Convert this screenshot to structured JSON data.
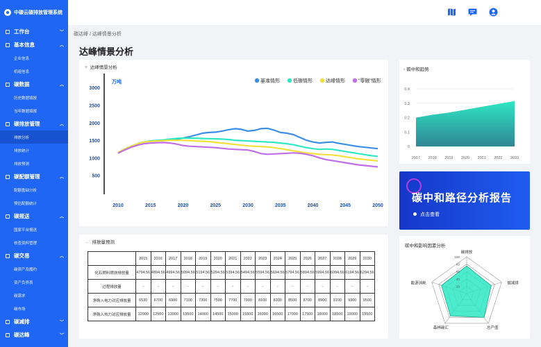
{
  "app": {
    "title": "中碳云碳排放管理系统"
  },
  "sidebar": {
    "groups": [
      {
        "label": "工作台",
        "items": []
      },
      {
        "label": "基本信息",
        "items": [
          "企业信息",
          "机组信息"
        ]
      },
      {
        "label": "碳数据",
        "items": [
          "历史数据填报",
          "当年数据填报"
        ]
      },
      {
        "label": "碳排放管理",
        "items": [
          "排放分析",
          "排放统计",
          "排放预测"
        ]
      },
      {
        "label": "碳配额管理",
        "items": [
          "配额盈缺分析",
          "预估配额统计"
        ]
      },
      {
        "label": "碳报送",
        "items": [
          "国家平台报送",
          "核查资料管理"
        ]
      },
      {
        "label": "碳交易",
        "items": [
          "碳资产及履约",
          "资产负债表",
          "碳需求",
          "碳市场"
        ]
      },
      {
        "label": "碳减排",
        "items": []
      },
      {
        "label": "碳达峰",
        "items": []
      }
    ]
  },
  "header": {
    "breadcrumb": "碳达峰 / 达峰情景分析",
    "page_title": "达峰情景分析",
    "icons": [
      "map-icon",
      "message-icon",
      "user-icon"
    ]
  },
  "main_chart_card": {
    "title": "达峰情景分析",
    "chart_data": {
      "type": "line",
      "title": "",
      "ylabel": "万吨",
      "x": [
        2010,
        2011,
        2012,
        2013,
        2014,
        2015,
        2016,
        2017,
        2018,
        2019,
        2020,
        2021,
        2022,
        2023,
        2024,
        2025,
        2026,
        2027,
        2028,
        2029,
        2030,
        2031,
        2032,
        2033,
        2034,
        2035,
        2036,
        2037,
        2038,
        2039,
        2040,
        2041,
        2042,
        2043,
        2044,
        2045,
        2046,
        2047,
        2048,
        2049,
        2050
      ],
      "xticks": [
        2010,
        2015,
        2020,
        2025,
        2030,
        2035,
        2040,
        2045,
        2050
      ],
      "yticks": [
        500,
        1000,
        1500,
        2000,
        2500,
        3000
      ],
      "ylim": [
        0,
        3200
      ],
      "legend": "top-right",
      "series": [
        {
          "name": "基准情形",
          "color": "#3a8ee6",
          "values": [
            1150,
            1250,
            1330,
            1400,
            1450,
            1480,
            1490,
            1500,
            1510,
            1530,
            1560,
            1600,
            1650,
            1700,
            1720,
            1730,
            1760,
            1800,
            1830,
            1810,
            1760,
            1780,
            1830,
            1840,
            1790,
            1720,
            1700,
            1660,
            1580,
            1500,
            1450,
            1420,
            1440,
            1450,
            1410,
            1380,
            1350,
            1320,
            1300,
            1280,
            1260
          ]
        },
        {
          "name": "低碳情形",
          "color": "#2ee8c4",
          "values": [
            1150,
            1250,
            1330,
            1400,
            1450,
            1480,
            1495,
            1510,
            1530,
            1550,
            1560,
            1560,
            1555,
            1550,
            1545,
            1540,
            1530,
            1520,
            1500,
            1490,
            1480,
            1470,
            1460,
            1450,
            1440,
            1420,
            1400,
            1370,
            1330,
            1290,
            1260,
            1240,
            1250,
            1240,
            1210,
            1180,
            1150,
            1120,
            1090,
            1060,
            1040
          ]
        },
        {
          "name": "达峰情形",
          "color": "#f2e13a",
          "values": [
            1150,
            1250,
            1330,
            1400,
            1450,
            1470,
            1480,
            1490,
            1495,
            1500,
            1495,
            1490,
            1480,
            1470,
            1460,
            1440,
            1420,
            1400,
            1380,
            1360,
            1340,
            1330,
            1320,
            1310,
            1290,
            1260,
            1230,
            1200,
            1170,
            1140,
            1120,
            1100,
            1090,
            1080,
            1060,
            1030,
            1000,
            970,
            950,
            930,
            910
          ]
        },
        {
          "name": "“零碳”情形",
          "color": "#c06ee8",
          "values": [
            1130,
            1220,
            1300,
            1360,
            1400,
            1420,
            1430,
            1435,
            1420,
            1390,
            1350,
            1330,
            1320,
            1310,
            1300,
            1290,
            1270,
            1250,
            1240,
            1230,
            1220,
            1180,
            1120,
            1100,
            1110,
            1120,
            1130,
            1140,
            1130,
            1100,
            1060,
            1000,
            950,
            920,
            890,
            860,
            830,
            800,
            780,
            760,
            740
          ]
        }
      ]
    }
  },
  "forecast_card": {
    "title": "排放量预测",
    "years": [
      "2015",
      "2016",
      "2017",
      "2018",
      "2019",
      "2020",
      "2021",
      "2022",
      "2023",
      "2024",
      "2025",
      "2026",
      "2027",
      "2028",
      "2029",
      "2030"
    ],
    "rows": [
      {
        "label": "化石燃料燃烧排放量",
        "values": [
          "4794.56",
          "4894.56",
          "4994.56",
          "5094.56",
          "5194.56",
          "5294.56",
          "5394.56",
          "5494.56",
          "5594.56",
          "5694.56",
          "5794.56",
          "5894.56",
          "5994.56",
          "6094.56",
          "6194.56",
          "6294.56"
        ]
      },
      {
        "label": "过程排放量",
        "values": [
          "-",
          "-",
          "-",
          "-",
          "-",
          "-",
          "-",
          "-",
          "-",
          "-",
          "-",
          "-",
          "-",
          "-",
          "-",
          "-"
        ]
      },
      {
        "label": "净购入电力对应排放量",
        "values": [
          "6530",
          "6700",
          "6900",
          "7100",
          "7300",
          "7500",
          "7700",
          "7900",
          "8100",
          "8300",
          "8500",
          "8700",
          "8900",
          "9100",
          "9300",
          "9500"
        ]
      },
      {
        "label": "净购入热力对应排放量",
        "values": [
          "12000",
          "12500",
          "13000",
          "13500",
          "14000",
          "14500",
          "15000",
          "15500",
          "16000",
          "16500",
          "17000",
          "17500",
          "18000",
          "18500",
          "19000",
          "19500"
        ]
      }
    ]
  },
  "trend_card": {
    "title": "碳中和趋势",
    "chart_data": {
      "type": "area",
      "x": [
        2017,
        2018,
        2019,
        2020,
        2021,
        2022,
        2023
      ],
      "values": [
        0.2,
        0.22,
        0.235,
        0.255,
        0.275,
        0.295,
        0.315
      ],
      "yticks": [
        0,
        0.1,
        0.2,
        0.3,
        0.4
      ],
      "ylim": [
        0,
        0.4
      ],
      "color": "#2ee8c4"
    }
  },
  "banner": {
    "title": "碳中和路径分析报告",
    "link_label": "点击查看"
  },
  "radar_card": {
    "title": "碳中和影响因素分析",
    "chart_data": {
      "type": "radar",
      "indicators": [
        "碳排放",
        "碳减排",
        "总产值",
        "森林碳汇",
        "能源消耗"
      ],
      "ticks": [
        0,
        20,
        40,
        60,
        80,
        100
      ],
      "max": 100,
      "values": [
        75,
        70,
        80,
        75,
        72
      ],
      "color": "#2ee8c4"
    }
  }
}
